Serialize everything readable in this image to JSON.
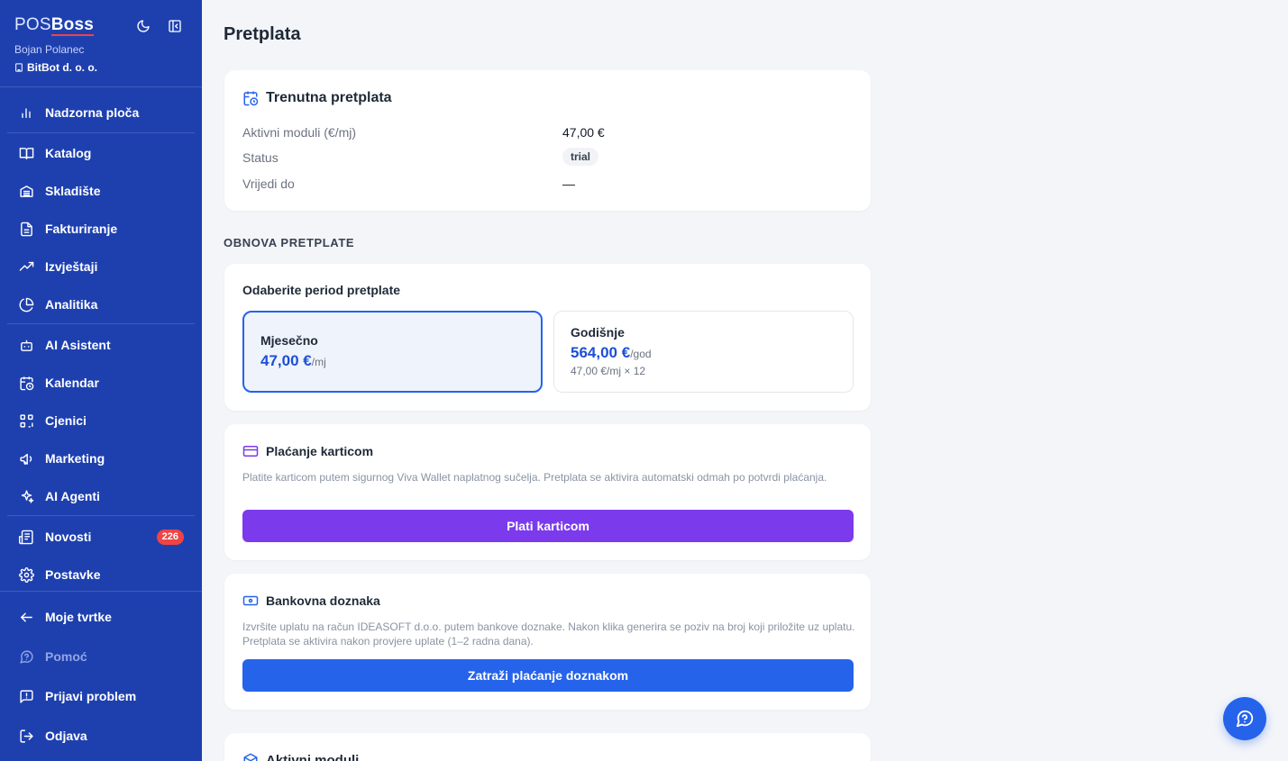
{
  "sidebar": {
    "brand_pos": "POS",
    "brand_boss": "Boss",
    "user_name": "Bojan Polanec",
    "company": "BitBot d. o. o.",
    "theme_toggle_icon": "moon-icon",
    "collapse_icon": "sidebar-collapse-icon",
    "items": [
      {
        "label": "Nadzorna ploča",
        "icon": "chart-bars-icon"
      },
      {
        "label": "Katalog",
        "icon": "book-icon"
      },
      {
        "label": "Skladište",
        "icon": "warehouse-icon"
      },
      {
        "label": "Fakturiranje",
        "icon": "document-icon"
      },
      {
        "label": "Izvještaji",
        "icon": "trending-up-icon"
      },
      {
        "label": "Analitika",
        "icon": "pie-chart-icon"
      },
      {
        "label": "AI Asistent",
        "icon": "robot-icon"
      },
      {
        "label": "Kalendar",
        "icon": "calendar-clock-icon"
      },
      {
        "label": "Cjenici",
        "icon": "qr-code-icon"
      },
      {
        "label": "Marketing",
        "icon": "megaphone-icon"
      },
      {
        "label": "AI Agenti",
        "icon": "sparkles-icon"
      },
      {
        "label": "Novosti",
        "icon": "newspaper-icon",
        "badge": "226"
      },
      {
        "label": "Postavke",
        "icon": "gear-icon"
      },
      {
        "label": "Moje tvrtke",
        "icon": "arrow-left-icon"
      },
      {
        "label": "Pomoć",
        "icon": "help-chat-icon"
      },
      {
        "label": "Prijavi problem",
        "icon": "message-alert-icon"
      },
      {
        "label": "Odjava",
        "icon": "logout-icon"
      }
    ]
  },
  "main": {
    "page_title": "Pretplata",
    "current": {
      "title": "Trenutna pretplata",
      "rows": [
        {
          "label": "Aktivni moduli (€/mj)",
          "value": "47,00 €"
        },
        {
          "label": "Status",
          "value": "trial"
        },
        {
          "label": "Vrijedi do",
          "value": "—"
        }
      ]
    },
    "renewal_section": "OBNOVA PRETPLATE",
    "period": {
      "prompt": "Odaberite period pretplate",
      "monthly": {
        "name": "Mjesečno",
        "price": "47,00 €",
        "unit": "/mj",
        "selected": true
      },
      "yearly": {
        "name": "Godišnje",
        "price": "564,00 €",
        "unit": "/god",
        "sub": "47,00 €/mj × 12",
        "selected": false
      }
    },
    "card_payment": {
      "title": "Plaćanje karticom",
      "description": "Platite karticom putem sigurnog Viva Wallet naplatnog sučelja. Pretplata se aktivira automatski odmah po potvrdi plaćanja.",
      "button": "Plati karticom"
    },
    "bank_transfer": {
      "title": "Bankovna doznaka",
      "description": "Izvršite uplatu na račun IDEASOFT d.o.o. putem bankove doznake. Nakon klika generira se poziv na broj koji priložite uz uplatu. Pretplata se aktivira nakon provjere uplate (1–2 radna dana).",
      "button": "Zatraži plaćanje doznakom"
    },
    "active_modules_title": "Aktivni moduli"
  },
  "colors": {
    "sidebar_bg": "#1e40af",
    "accent_blue": "#2563eb",
    "accent_purple": "#7c3aed",
    "badge_red": "#ef4444"
  }
}
